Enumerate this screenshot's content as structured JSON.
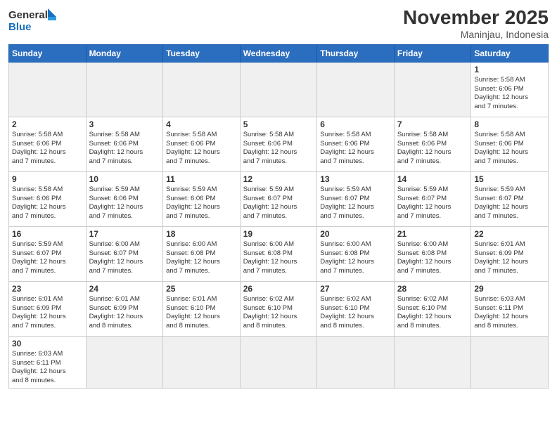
{
  "logo": {
    "general": "General",
    "blue": "Blue"
  },
  "header": {
    "month": "November 2025",
    "location": "Maninjau, Indonesia"
  },
  "days": [
    "Sunday",
    "Monday",
    "Tuesday",
    "Wednesday",
    "Thursday",
    "Friday",
    "Saturday"
  ],
  "weeks": [
    [
      {
        "date": "",
        "empty": true,
        "info": ""
      },
      {
        "date": "",
        "empty": true,
        "info": ""
      },
      {
        "date": "",
        "empty": true,
        "info": ""
      },
      {
        "date": "",
        "empty": true,
        "info": ""
      },
      {
        "date": "",
        "empty": true,
        "info": ""
      },
      {
        "date": "",
        "empty": true,
        "info": ""
      },
      {
        "date": "1",
        "empty": false,
        "info": "Sunrise: 5:58 AM\nSunset: 6:06 PM\nDaylight: 12 hours\nand 7 minutes."
      }
    ],
    [
      {
        "date": "2",
        "empty": false,
        "info": "Sunrise: 5:58 AM\nSunset: 6:06 PM\nDaylight: 12 hours\nand 7 minutes."
      },
      {
        "date": "3",
        "empty": false,
        "info": "Sunrise: 5:58 AM\nSunset: 6:06 PM\nDaylight: 12 hours\nand 7 minutes."
      },
      {
        "date": "4",
        "empty": false,
        "info": "Sunrise: 5:58 AM\nSunset: 6:06 PM\nDaylight: 12 hours\nand 7 minutes."
      },
      {
        "date": "5",
        "empty": false,
        "info": "Sunrise: 5:58 AM\nSunset: 6:06 PM\nDaylight: 12 hours\nand 7 minutes."
      },
      {
        "date": "6",
        "empty": false,
        "info": "Sunrise: 5:58 AM\nSunset: 6:06 PM\nDaylight: 12 hours\nand 7 minutes."
      },
      {
        "date": "7",
        "empty": false,
        "info": "Sunrise: 5:58 AM\nSunset: 6:06 PM\nDaylight: 12 hours\nand 7 minutes."
      },
      {
        "date": "8",
        "empty": false,
        "info": "Sunrise: 5:58 AM\nSunset: 6:06 PM\nDaylight: 12 hours\nand 7 minutes."
      }
    ],
    [
      {
        "date": "9",
        "empty": false,
        "info": "Sunrise: 5:58 AM\nSunset: 6:06 PM\nDaylight: 12 hours\nand 7 minutes."
      },
      {
        "date": "10",
        "empty": false,
        "info": "Sunrise: 5:59 AM\nSunset: 6:06 PM\nDaylight: 12 hours\nand 7 minutes."
      },
      {
        "date": "11",
        "empty": false,
        "info": "Sunrise: 5:59 AM\nSunset: 6:06 PM\nDaylight: 12 hours\nand 7 minutes."
      },
      {
        "date": "12",
        "empty": false,
        "info": "Sunrise: 5:59 AM\nSunset: 6:07 PM\nDaylight: 12 hours\nand 7 minutes."
      },
      {
        "date": "13",
        "empty": false,
        "info": "Sunrise: 5:59 AM\nSunset: 6:07 PM\nDaylight: 12 hours\nand 7 minutes."
      },
      {
        "date": "14",
        "empty": false,
        "info": "Sunrise: 5:59 AM\nSunset: 6:07 PM\nDaylight: 12 hours\nand 7 minutes."
      },
      {
        "date": "15",
        "empty": false,
        "info": "Sunrise: 5:59 AM\nSunset: 6:07 PM\nDaylight: 12 hours\nand 7 minutes."
      }
    ],
    [
      {
        "date": "16",
        "empty": false,
        "info": "Sunrise: 5:59 AM\nSunset: 6:07 PM\nDaylight: 12 hours\nand 7 minutes."
      },
      {
        "date": "17",
        "empty": false,
        "info": "Sunrise: 6:00 AM\nSunset: 6:07 PM\nDaylight: 12 hours\nand 7 minutes."
      },
      {
        "date": "18",
        "empty": false,
        "info": "Sunrise: 6:00 AM\nSunset: 6:08 PM\nDaylight: 12 hours\nand 7 minutes."
      },
      {
        "date": "19",
        "empty": false,
        "info": "Sunrise: 6:00 AM\nSunset: 6:08 PM\nDaylight: 12 hours\nand 7 minutes."
      },
      {
        "date": "20",
        "empty": false,
        "info": "Sunrise: 6:00 AM\nSunset: 6:08 PM\nDaylight: 12 hours\nand 7 minutes."
      },
      {
        "date": "21",
        "empty": false,
        "info": "Sunrise: 6:00 AM\nSunset: 6:08 PM\nDaylight: 12 hours\nand 7 minutes."
      },
      {
        "date": "22",
        "empty": false,
        "info": "Sunrise: 6:01 AM\nSunset: 6:09 PM\nDaylight: 12 hours\nand 7 minutes."
      }
    ],
    [
      {
        "date": "23",
        "empty": false,
        "info": "Sunrise: 6:01 AM\nSunset: 6:09 PM\nDaylight: 12 hours\nand 7 minutes."
      },
      {
        "date": "24",
        "empty": false,
        "info": "Sunrise: 6:01 AM\nSunset: 6:09 PM\nDaylight: 12 hours\nand 8 minutes."
      },
      {
        "date": "25",
        "empty": false,
        "info": "Sunrise: 6:01 AM\nSunset: 6:10 PM\nDaylight: 12 hours\nand 8 minutes."
      },
      {
        "date": "26",
        "empty": false,
        "info": "Sunrise: 6:02 AM\nSunset: 6:10 PM\nDaylight: 12 hours\nand 8 minutes."
      },
      {
        "date": "27",
        "empty": false,
        "info": "Sunrise: 6:02 AM\nSunset: 6:10 PM\nDaylight: 12 hours\nand 8 minutes."
      },
      {
        "date": "28",
        "empty": false,
        "info": "Sunrise: 6:02 AM\nSunset: 6:10 PM\nDaylight: 12 hours\nand 8 minutes."
      },
      {
        "date": "29",
        "empty": false,
        "info": "Sunrise: 6:03 AM\nSunset: 6:11 PM\nDaylight: 12 hours\nand 8 minutes."
      }
    ],
    [
      {
        "date": "30",
        "empty": false,
        "info": "Sunrise: 6:03 AM\nSunset: 6:11 PM\nDaylight: 12 hours\nand 8 minutes."
      },
      {
        "date": "",
        "empty": true,
        "info": ""
      },
      {
        "date": "",
        "empty": true,
        "info": ""
      },
      {
        "date": "",
        "empty": true,
        "info": ""
      },
      {
        "date": "",
        "empty": true,
        "info": ""
      },
      {
        "date": "",
        "empty": true,
        "info": ""
      },
      {
        "date": "",
        "empty": true,
        "info": ""
      }
    ]
  ]
}
